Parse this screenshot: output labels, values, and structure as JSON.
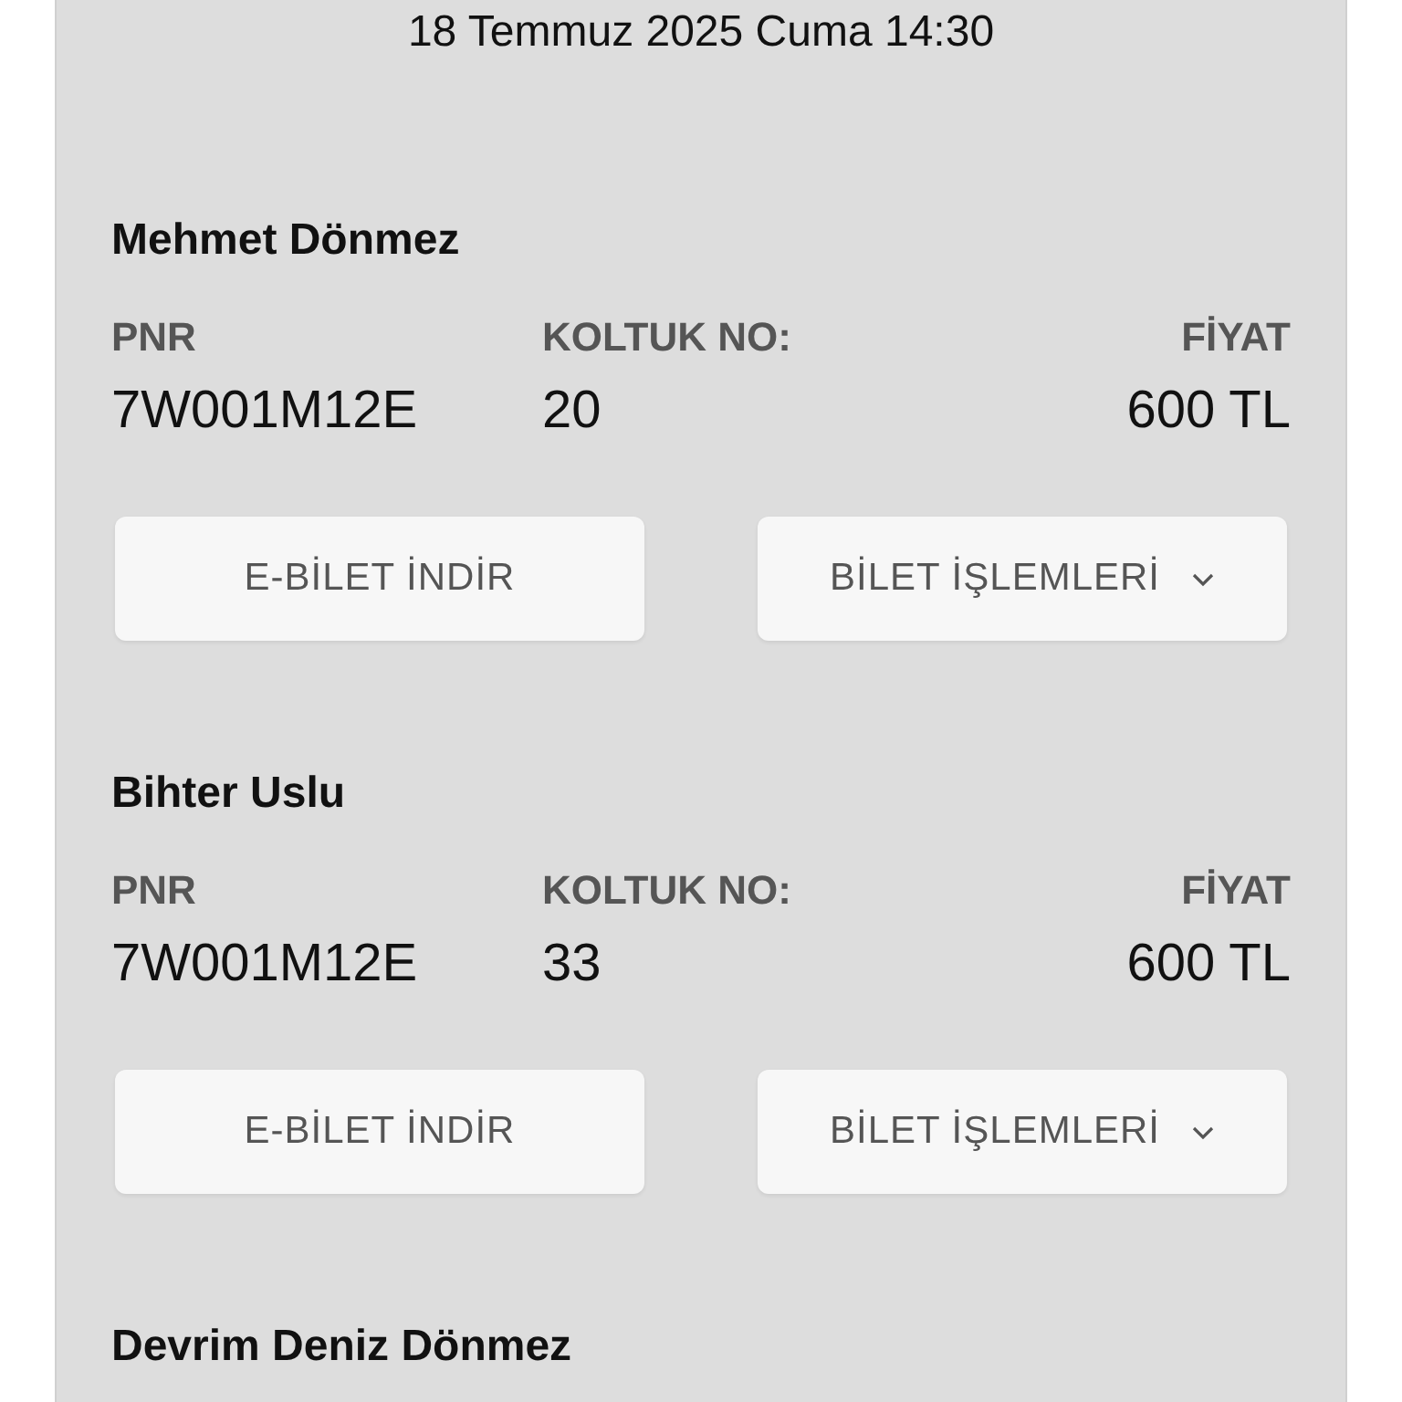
{
  "date": "18 Temmuz 2025 Cuma 14:30",
  "passengers": [
    {
      "name": "Mehmet Dönmez",
      "pnr_label": "PNR",
      "pnr": "7W001M12E",
      "seat_label": "KOLTUK NO:",
      "seat": "20",
      "price_label": "FİYAT",
      "price": "600 TL",
      "buttons": [
        {
          "label": "E-BİLET İNDİR",
          "kind": "plain"
        },
        {
          "label": "BİLET İŞLEMLERİ",
          "kind": "dropdown"
        }
      ]
    },
    {
      "name": "Bihter Uslu",
      "pnr_label": "PNR",
      "pnr": "7W001M12E",
      "seat_label": "KOLTUK NO:",
      "seat": "33",
      "price_label": "FİYAT",
      "price": "600 TL",
      "buttons": [
        {
          "label": "E-BİLET İNDİR",
          "kind": "plain"
        },
        {
          "label": "BİLET İŞLEMLERİ",
          "kind": "dropdown"
        }
      ]
    },
    {
      "name": "Devrim Deniz Dönmez"
    }
  ]
}
